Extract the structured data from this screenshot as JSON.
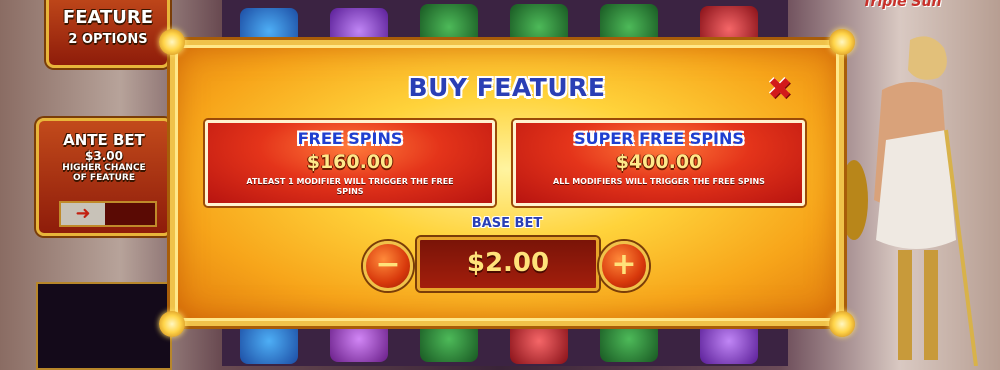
{
  "game": {
    "logo_text": "Triple Sun"
  },
  "left_panel": {
    "feature_title": "FEATURE",
    "feature_subtitle": "2 OPTIONS",
    "ante_title": "ANTE BET",
    "ante_amount": "$3.00",
    "ante_desc_line1": "HIGHER CHANCE",
    "ante_desc_line2": "OF FEATURE"
  },
  "modal": {
    "title": "BUY FEATURE",
    "close_glyph": "✖",
    "options": [
      {
        "title": "FREE SPINS",
        "price": "$160.00",
        "desc": "ATLEAST 1 MODIFIER WILL TRIGGER THE FREE SPINS"
      },
      {
        "title": "SUPER FREE SPINS",
        "price": "$400.00",
        "desc": "ALL MODIFIERS WILL TRIGGER THE FREE SPINS"
      }
    ],
    "base_bet_label": "BASE BET",
    "base_bet_value": "$2.00",
    "minus_glyph": "−",
    "plus_glyph": "+"
  },
  "colors": {
    "title_blue": "#2a3fb5",
    "option_red": "#e4341a",
    "price_gold": "#ffe98a",
    "close_red": "#d21a1a",
    "frame_gold": "#f0c24a"
  },
  "icons": [
    "close-icon",
    "minus-icon",
    "plus-icon",
    "arrow-right-icon",
    "sun-corner-icon"
  ]
}
